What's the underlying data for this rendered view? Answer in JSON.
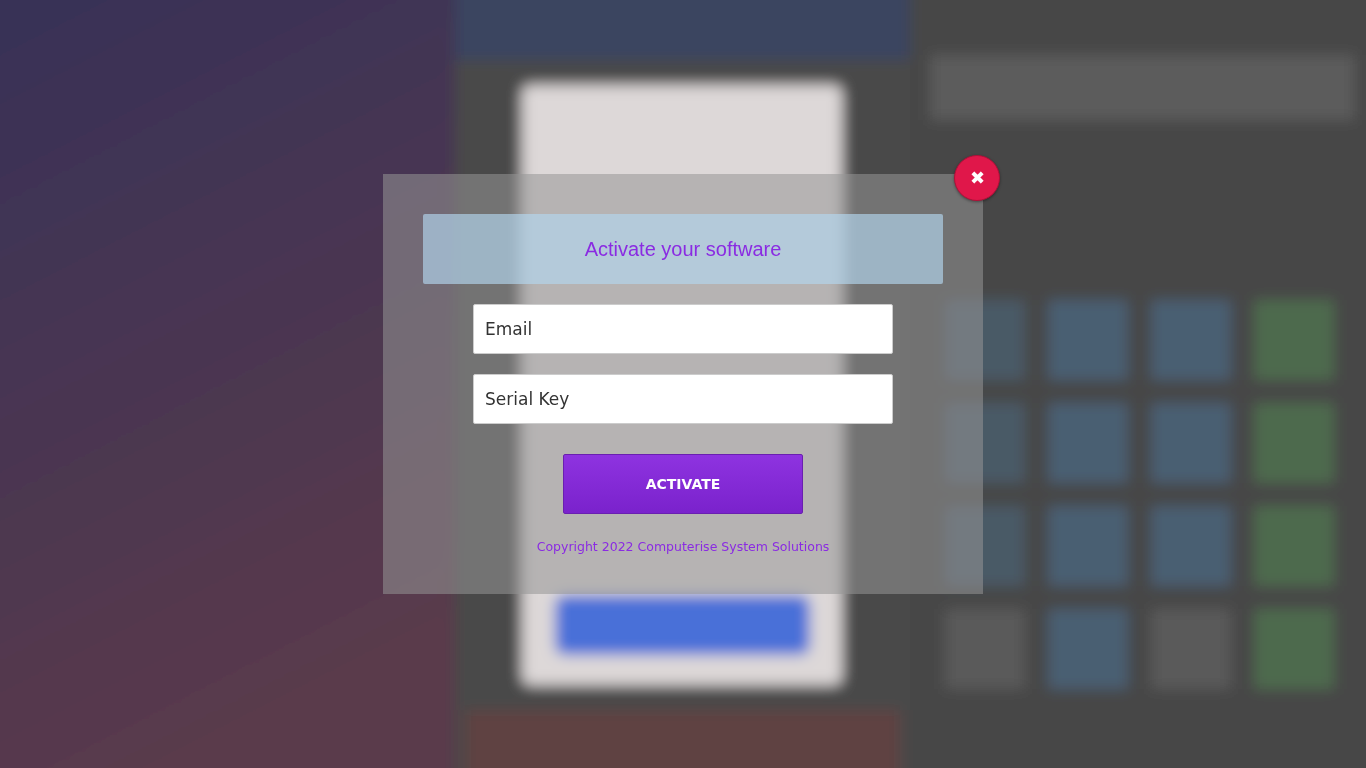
{
  "dialog": {
    "title": "Activate your software",
    "fields": [
      {
        "placeholder": "Email"
      },
      {
        "placeholder": "Serial Key"
      }
    ],
    "button": "ACTIVATE",
    "footer": "Copyright 2022 Computerise System Solutions",
    "close": "✖"
  }
}
